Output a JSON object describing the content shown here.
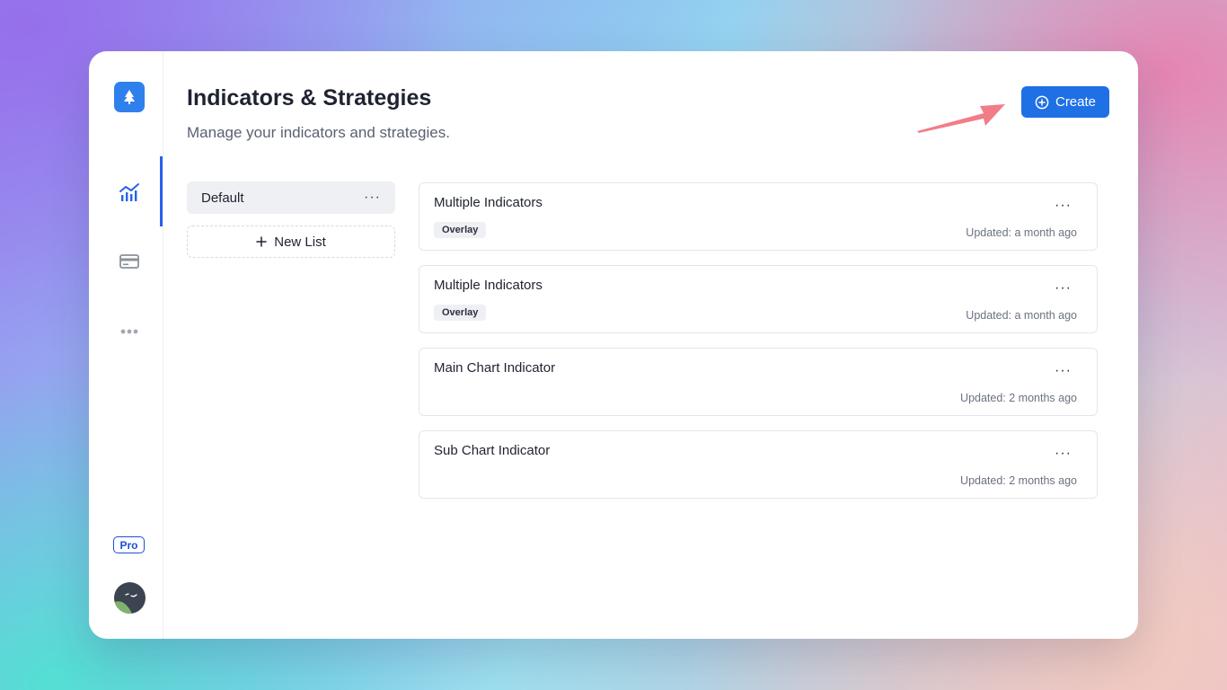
{
  "colors": {
    "accent": "#1f6fe5",
    "logo": "#2f80ed",
    "annotation_arrow": "#f27d88",
    "active_indicator": "#2563eb"
  },
  "sidebar": {
    "nav": [
      {
        "icon": "chart-icon",
        "active": true
      },
      {
        "icon": "card-icon",
        "active": false
      },
      {
        "icon": "more-icon",
        "active": false
      }
    ],
    "pro_label": "Pro",
    "logo_icon": "tree-icon"
  },
  "header": {
    "title": "Indicators & Strategies",
    "subtitle": "Manage your indicators and strategies.",
    "create_label": "Create",
    "create_icon": "plus-circle-icon"
  },
  "lists": {
    "items": [
      {
        "label": "Default",
        "menu": "···"
      }
    ],
    "new_list_label": "New List"
  },
  "cards": [
    {
      "name": "Multiple Indicators",
      "badge": "Overlay",
      "updated": "Updated: a month ago",
      "menu": "···"
    },
    {
      "name": "Multiple Indicators",
      "badge": "Overlay",
      "updated": "Updated: a month ago",
      "menu": "···"
    },
    {
      "name": "Main Chart Indicator",
      "badge": "",
      "updated": "Updated: 2 months ago",
      "menu": "···"
    },
    {
      "name": "Sub Chart Indicator",
      "badge": "",
      "updated": "Updated: 2 months ago",
      "menu": "···"
    }
  ]
}
